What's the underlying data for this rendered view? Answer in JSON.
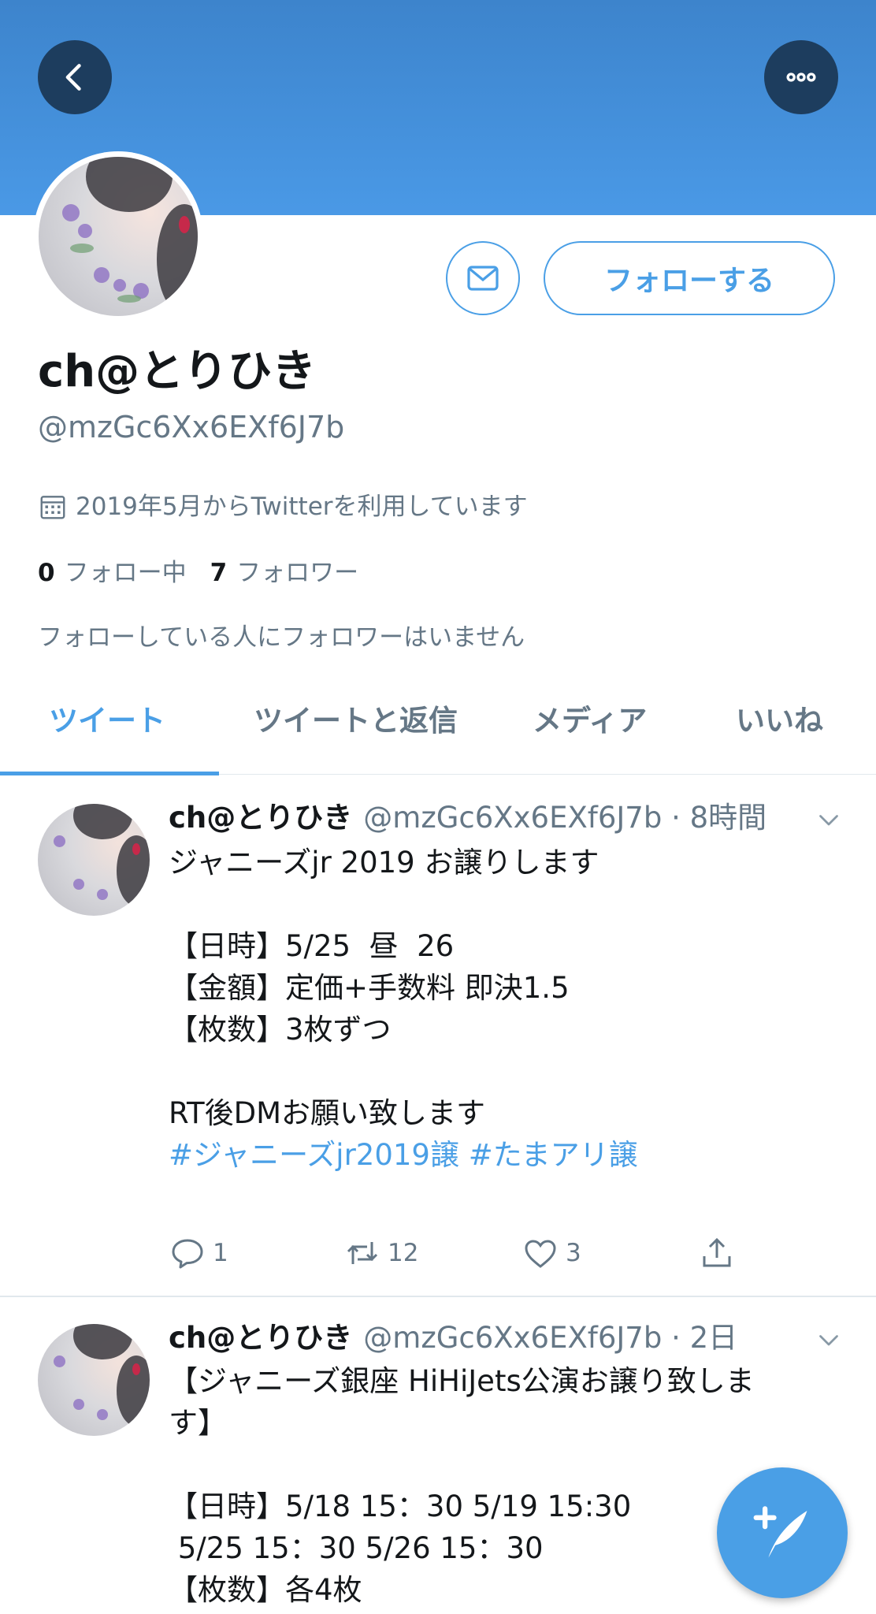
{
  "header": {
    "back_icon": "chevron-left-icon",
    "more_icon": "more-horizontal-icon",
    "banner_color": "#4a99e6"
  },
  "profile": {
    "name": "ch@とりひき",
    "handle": "@mzGc6Xx6EXf6J7b",
    "joined": "2019年5月からTwitterを利用しています",
    "following_count": "0",
    "following_label": "フォロー中",
    "followers_count": "7",
    "followers_label": "フォロワー",
    "mutual_note": "フォローしている人にフォロワーはいません",
    "follow_button": "フォローする",
    "dm_icon": "mail-icon"
  },
  "tabs": [
    {
      "label": "ツイート",
      "active": true
    },
    {
      "label": "ツイートと返信",
      "active": false
    },
    {
      "label": "メディア",
      "active": false
    },
    {
      "label": "いいね",
      "active": false
    }
  ],
  "tweets": [
    {
      "name": "ch@とりひき",
      "handle_time": "@mzGc6Xx6EXf6J7b · 8時間",
      "body": "ジャニーズjr 2019 お譲りします\n\n【日時】5/25  昼  26\n【金額】定価+手数料 即決1.5\n【枚数】3枚ずつ\n\nRT後DMお願い致します\n",
      "hashtags": "#ジャニーズjr2019譲 #たまアリ譲",
      "replies": "1",
      "retweets": "12",
      "likes": "3"
    },
    {
      "name": "ch@とりひき",
      "handle_time": "@mzGc6Xx6EXf6J7b · 2日",
      "body": "【ジャニーズ銀座 HiHiJets公演お譲り致しま\nす】\n\n【日時】5/18 15：30 5/19 15:30\n 5/25 15：30 5/26 15：30\n【枚数】各4枚"
    }
  ],
  "fab": {
    "icon": "compose-tweet-icon",
    "color": "#4a9fe6"
  }
}
